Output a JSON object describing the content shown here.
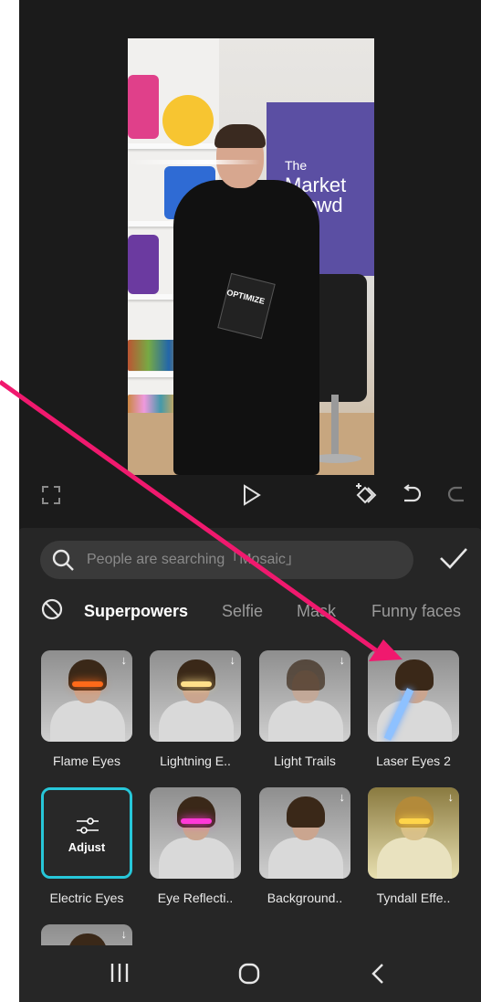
{
  "video": {
    "banner_line1": "The",
    "banner_line2": "Market",
    "banner_line3": "Crowd",
    "book_title": "OPTIMIZE"
  },
  "toolbar": {
    "icons": [
      "fullscreen-icon",
      "play-icon",
      "keyframe-icon",
      "undo-icon",
      "redo-icon"
    ]
  },
  "search": {
    "placeholder": "People are searching「Mosaic」"
  },
  "categories": [
    {
      "label": "Superpowers",
      "active": true
    },
    {
      "label": "Selfie",
      "active": false
    },
    {
      "label": "Mask",
      "active": false
    },
    {
      "label": "Funny faces",
      "active": false
    }
  ],
  "effects": [
    {
      "label": "Flame Eyes",
      "download": true,
      "eyes_color": "#ff6a1a"
    },
    {
      "label": "Lightning E..",
      "download": true,
      "eyes_color": "#ffe08a"
    },
    {
      "label": "Light Trails",
      "download": true,
      "eyes_color": "#dcdcdc"
    },
    {
      "label": "Laser Eyes 2",
      "download": false,
      "eyes_color": "#6aa8ff"
    },
    {
      "label": "Electric Eyes",
      "download": false,
      "selected": true,
      "overlay": "Adjust"
    },
    {
      "label": "Eye Reflecti..",
      "download": false,
      "eyes_color": "#ff39d8"
    },
    {
      "label": "Background..",
      "download": true,
      "eyes_color": "#e0e0e0"
    },
    {
      "label": "Tyndall Effe..",
      "download": true,
      "eyes_color": "#ffd54a"
    }
  ],
  "colors": {
    "accent": "#27c7d9",
    "annotation_arrow": "#f0196e"
  }
}
